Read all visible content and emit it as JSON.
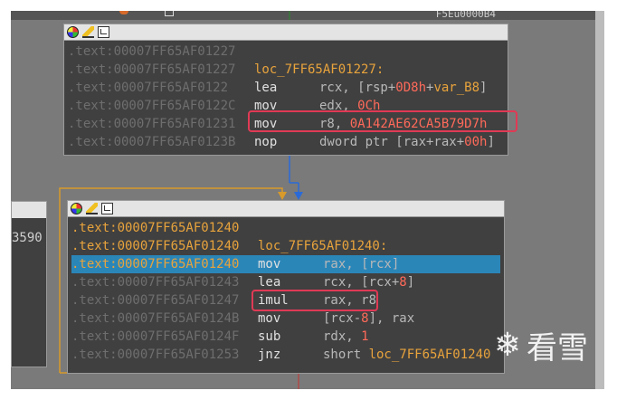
{
  "top_strip": {
    "address_fragment": "F5Eu0000B4"
  },
  "left_node": {
    "text": "3590"
  },
  "node1": {
    "lines": [
      {
        "addr": ".text:00007FF65AF01227",
        "label": "",
        "mnemonic": "",
        "operands": []
      },
      {
        "addr": ".text:00007FF65AF01227",
        "label": "loc_7FF65AF01227:",
        "mnemonic": "",
        "operands": []
      },
      {
        "addr": ".text:00007FF65AF0122",
        "label": "",
        "mnemonic": "lea",
        "operands": [
          {
            "t": "reg",
            "v": "rcx, [rsp+"
          },
          {
            "t": "num",
            "v": "0D8h"
          },
          {
            "t": "reg",
            "v": "+"
          },
          {
            "t": "lbl",
            "v": "var_B8"
          },
          {
            "t": "reg",
            "v": "]"
          }
        ]
      },
      {
        "addr": ".text:00007FF65AF0122C",
        "label": "",
        "mnemonic": "mov",
        "operands": [
          {
            "t": "reg",
            "v": "edx, "
          },
          {
            "t": "num",
            "v": "0Ch"
          }
        ]
      },
      {
        "addr": ".text:00007FF65AF01231",
        "label": "",
        "mnemonic": "mov",
        "operands": [
          {
            "t": "reg",
            "v": "r8, "
          },
          {
            "t": "num",
            "v": "0A142AE62CA5B79D7h"
          }
        ]
      },
      {
        "addr": ".text:00007FF65AF0123B",
        "label": "",
        "mnemonic": "nop",
        "operands": [
          {
            "t": "reg",
            "v": "dword ptr [rax+rax+"
          },
          {
            "t": "num",
            "v": "00h"
          },
          {
            "t": "reg",
            "v": "]"
          }
        ]
      }
    ]
  },
  "node2": {
    "lines": [
      {
        "addr": ".text:00007FF65AF01240",
        "label": "",
        "mnemonic": "",
        "operands": [],
        "style": "hi"
      },
      {
        "addr": ".text:00007FF65AF01240",
        "label": "loc_7FF65AF01240:",
        "mnemonic": "",
        "operands": [],
        "style": "hi"
      },
      {
        "addr": ".text:00007FF65AF01240",
        "label": "",
        "mnemonic": "mov",
        "operands": [
          {
            "t": "reg",
            "v": "rax, [rcx]"
          }
        ],
        "style": "sel"
      },
      {
        "addr": ".text:00007FF65AF01243",
        "label": "",
        "mnemonic": "lea",
        "operands": [
          {
            "t": "reg",
            "v": "rcx, [rcx+"
          },
          {
            "t": "num",
            "v": "8"
          },
          {
            "t": "reg",
            "v": "]"
          }
        ],
        "style": "dim"
      },
      {
        "addr": ".text:00007FF65AF01247",
        "label": "",
        "mnemonic": "imul",
        "operands": [
          {
            "t": "reg",
            "v": "rax, r8"
          }
        ],
        "style": "dim"
      },
      {
        "addr": ".text:00007FF65AF0124B",
        "label": "",
        "mnemonic": "mov",
        "operands": [
          {
            "t": "reg",
            "v": "[rcx-"
          },
          {
            "t": "num",
            "v": "8"
          },
          {
            "t": "reg",
            "v": "], rax"
          }
        ],
        "style": "dim"
      },
      {
        "addr": ".text:00007FF65AF0124F",
        "label": "",
        "mnemonic": "sub",
        "operands": [
          {
            "t": "reg",
            "v": "rdx, "
          },
          {
            "t": "num",
            "v": "1"
          }
        ],
        "style": "dim"
      },
      {
        "addr": ".text:00007FF65AF01253",
        "label": "",
        "mnemonic": "jnz",
        "operands": [
          {
            "t": "reg",
            "v": "short "
          },
          {
            "t": "lbl",
            "v": "loc_7FF65AF01240"
          }
        ],
        "style": "dim"
      }
    ]
  },
  "watermark": {
    "text": "看雪",
    "flake": "❄"
  },
  "colors": {
    "highlight_box": "#e03a55",
    "selection": "#2b86b8",
    "label": "#e8a33c",
    "number": "#ff6a5a"
  }
}
